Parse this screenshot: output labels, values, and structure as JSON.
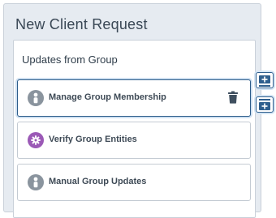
{
  "panel": {
    "title": "New Client Request"
  },
  "group": {
    "title": "Updates from Group",
    "items": [
      {
        "label": "Manage Group Membership",
        "icon": "person-icon",
        "icon_color": "#8a949e",
        "selected": true
      },
      {
        "label": "Verify Group Entities",
        "icon": "gear-icon",
        "icon_color": "#9b59b6",
        "selected": false
      },
      {
        "label": "Manual Group Updates",
        "icon": "person-icon",
        "icon_color": "#8a949e",
        "selected": false
      }
    ]
  },
  "colors": {
    "accent": "#2f5f8e",
    "delete": "#3f4f5f",
    "panel_bg": "#e6ebf1"
  },
  "side_buttons": [
    {
      "icon": "add-above-icon"
    },
    {
      "icon": "add-below-icon"
    }
  ]
}
